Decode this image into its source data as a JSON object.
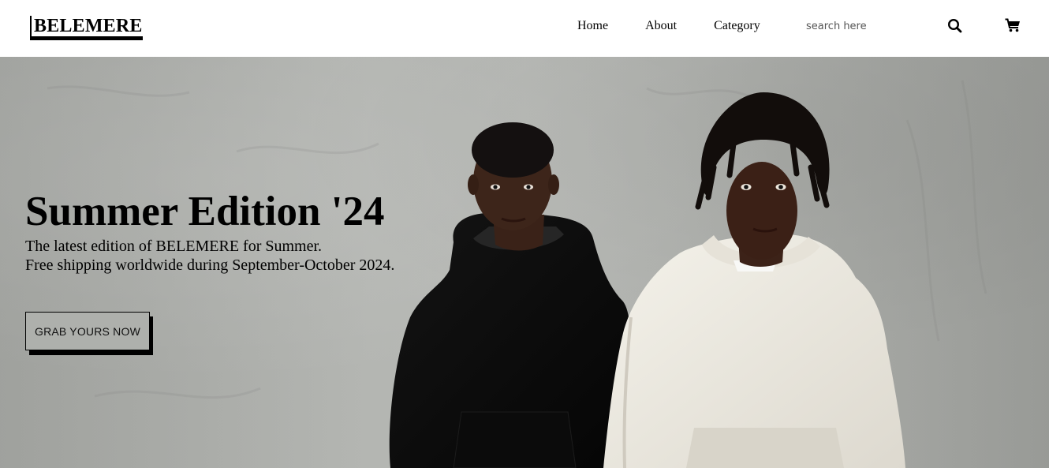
{
  "header": {
    "logo": "BELEMERE",
    "nav": [
      {
        "label": "Home"
      },
      {
        "label": "About"
      },
      {
        "label": "Category"
      }
    ],
    "search": {
      "placeholder": "search here",
      "value": ""
    },
    "icons": {
      "search": "search-icon",
      "cart": "cart-icon"
    }
  },
  "hero": {
    "title": "Summer Edition '24",
    "subtitle_line1": "The latest edition of BELEMERE for Summer.",
    "subtitle_line2": "Free shipping worldwide during September-October 2024.",
    "cta_label": "GRAB YOURS NOW",
    "image": "hero-photo-two-models"
  },
  "colors": {
    "background": "#ffffff",
    "hero_wall": "#b0b2ae",
    "text": "#000000"
  }
}
